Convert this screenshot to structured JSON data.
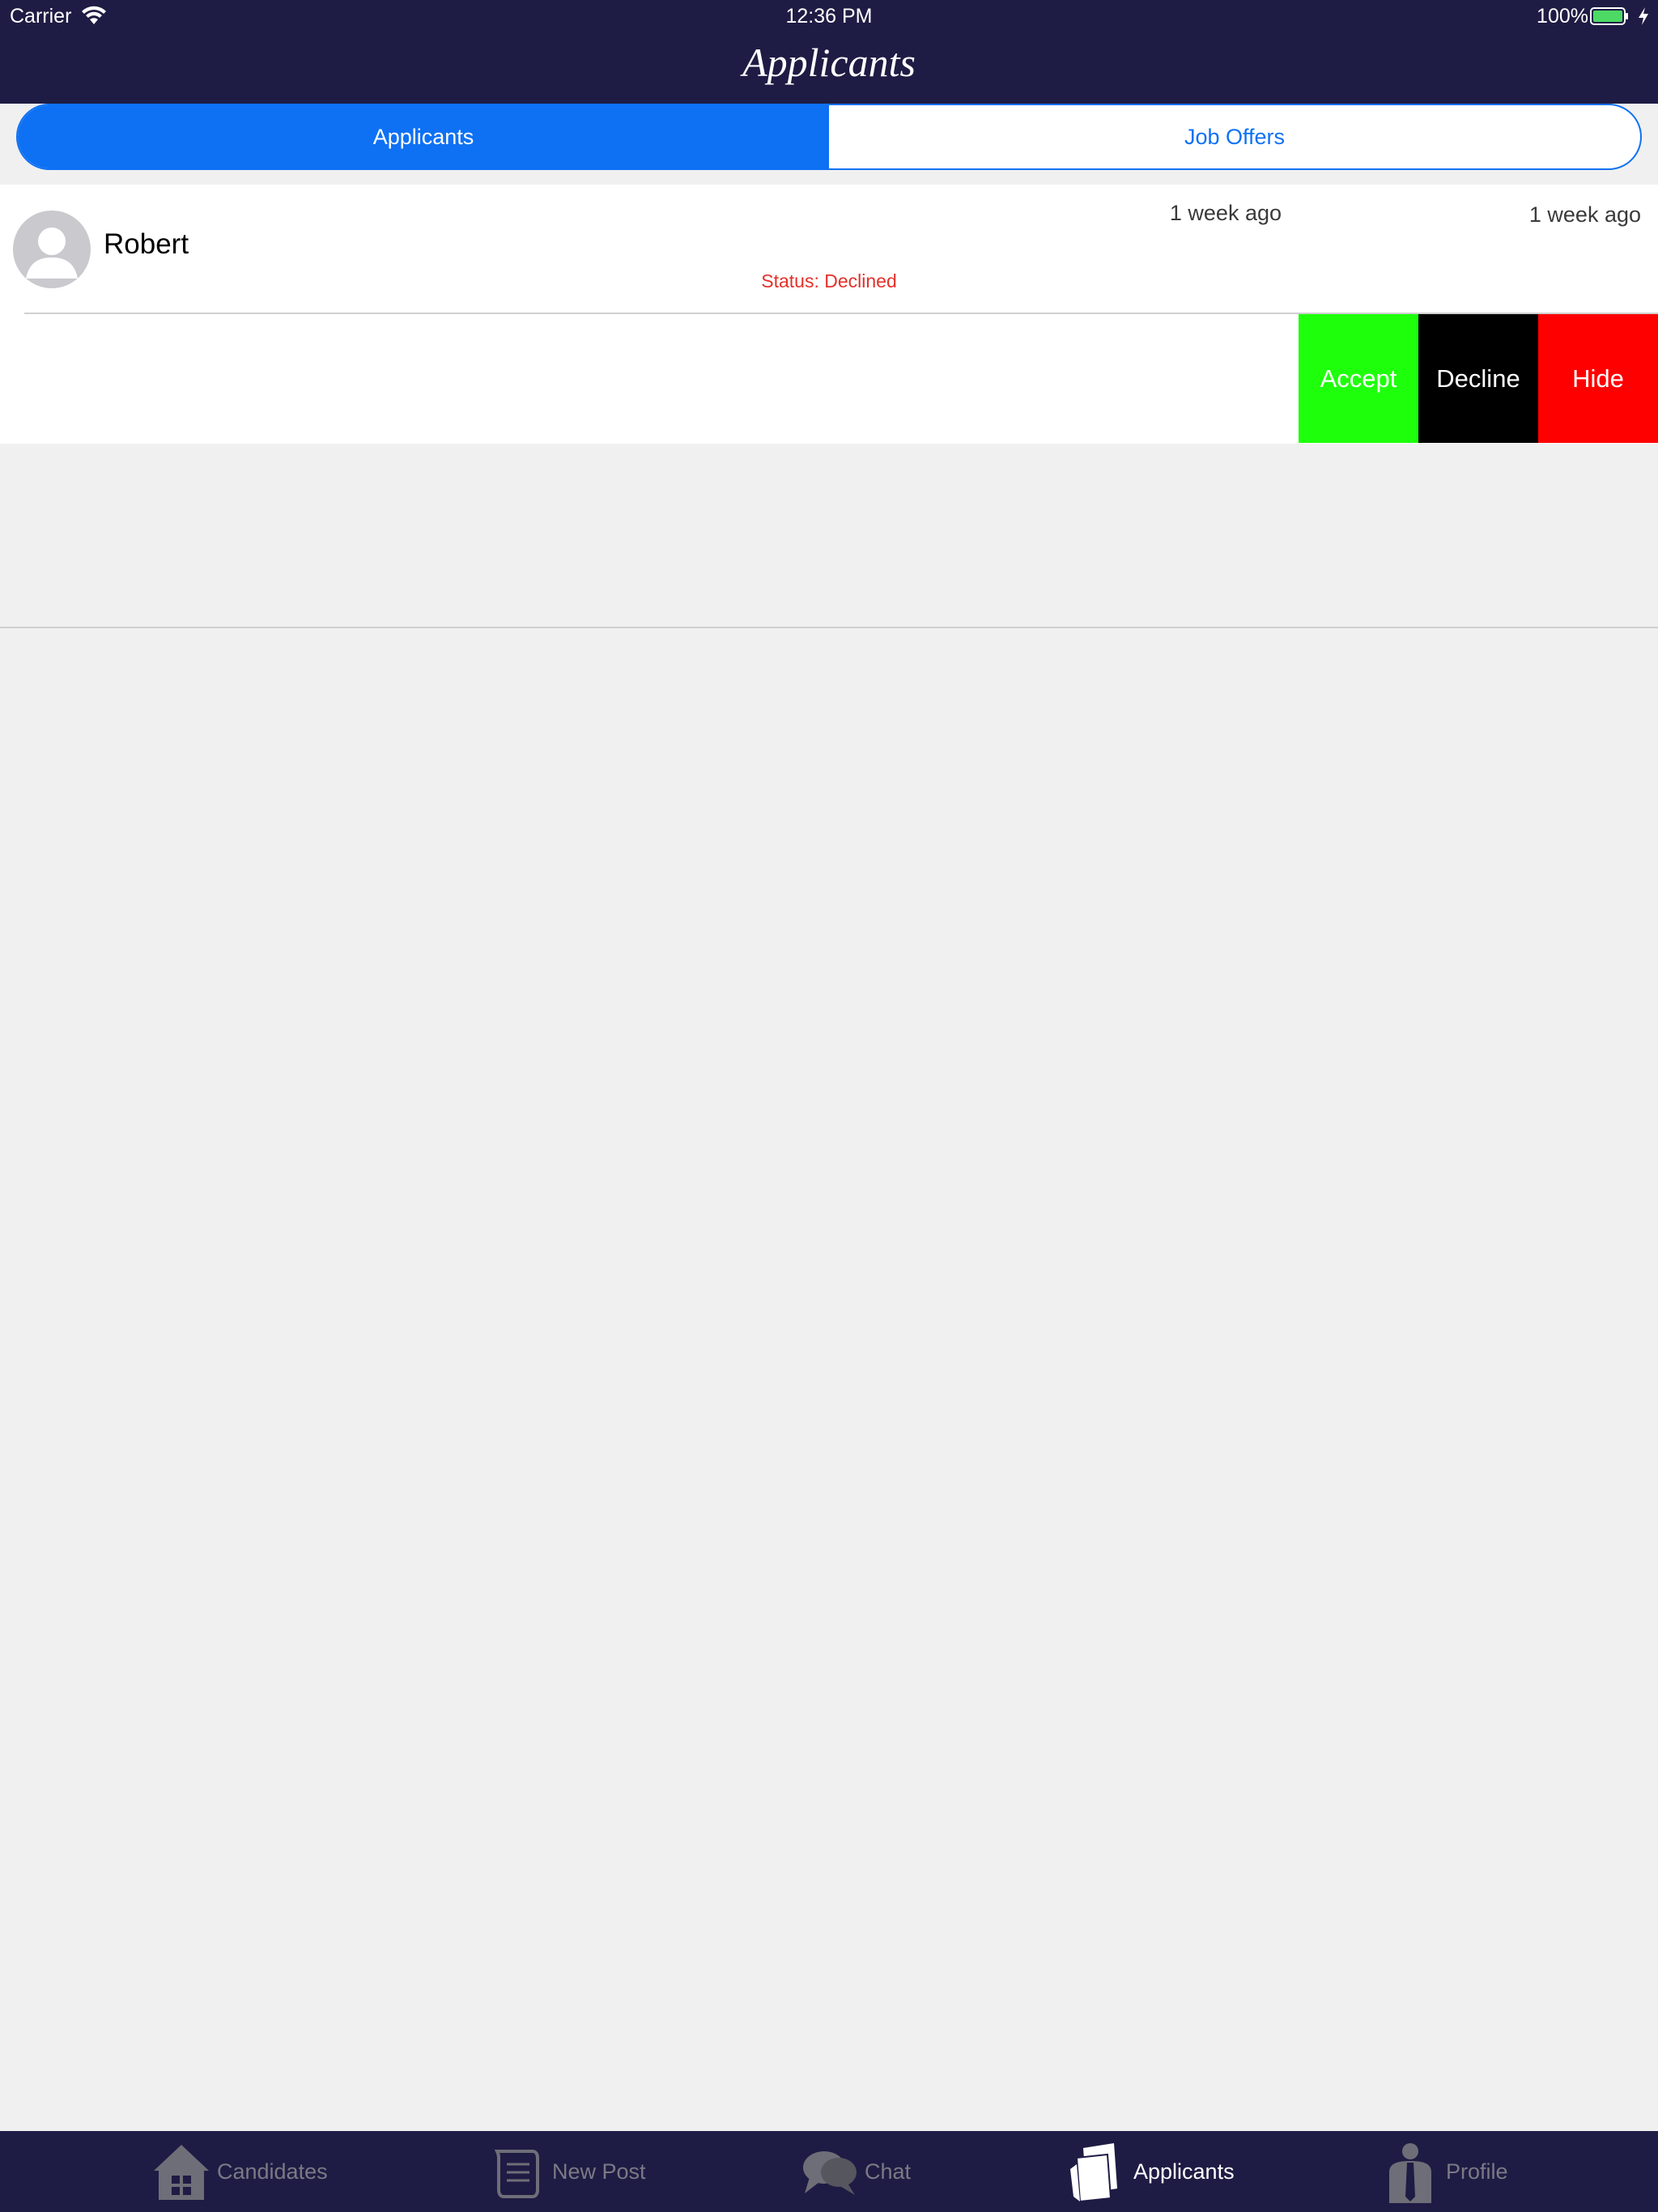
{
  "status_bar": {
    "carrier": "Carrier",
    "time": "12:36 PM",
    "battery": "100%"
  },
  "nav": {
    "title": "Applicants"
  },
  "segmented": {
    "items": [
      {
        "label": "Applicants",
        "active": true
      },
      {
        "label": "Job Offers",
        "active": false
      }
    ]
  },
  "list": {
    "rows": [
      {
        "name": "Robert",
        "time": "1 week ago",
        "status": "Status: Declined"
      },
      {
        "time": "1 week ago"
      }
    ],
    "swipe_actions": {
      "accept": "Accept",
      "decline": "Decline",
      "hide": "Hide"
    }
  },
  "tabbar": {
    "items": [
      {
        "label": "Candidates",
        "icon": "house-icon",
        "active": false
      },
      {
        "label": "New Post",
        "icon": "scroll-icon",
        "active": false
      },
      {
        "label": "Chat",
        "icon": "chat-bubbles-icon",
        "active": false
      },
      {
        "label": "Applicants",
        "icon": "stacked-papers-icon",
        "active": true
      },
      {
        "label": "Profile",
        "icon": "person-icon",
        "active": false
      }
    ]
  },
  "colors": {
    "header_bg": "#1e1c44",
    "accent_blue": "#0e71f4",
    "accept_green": "#1eff0c",
    "decline_black": "#000000",
    "hide_red": "#ff0000",
    "status_red": "#e5302a"
  }
}
